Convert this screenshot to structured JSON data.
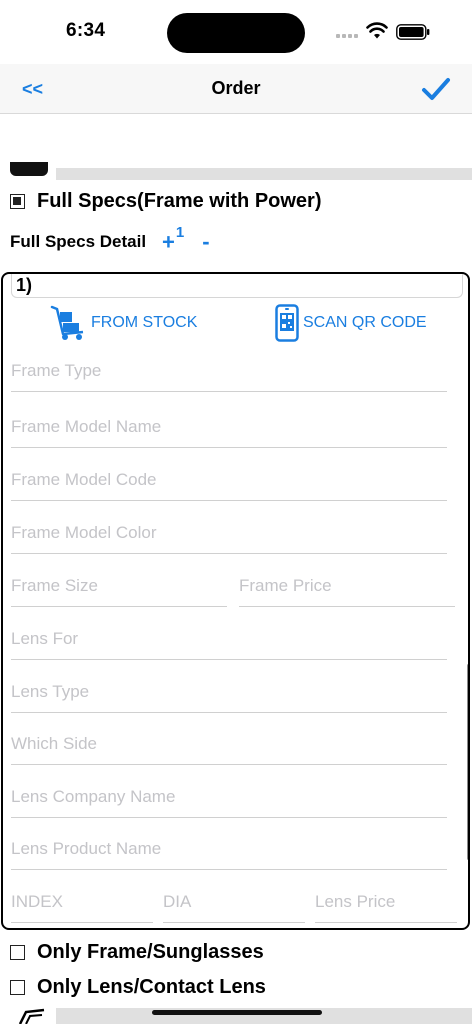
{
  "status_bar": {
    "time": "6:34"
  },
  "nav": {
    "back_label": "<<",
    "title": "Order",
    "done_icon": "checkmark-icon"
  },
  "options": {
    "full_specs": {
      "label": "Full Specs(Frame with Power)",
      "checked": true
    },
    "only_frame": {
      "label": "Only Frame/Sunglasses",
      "checked": false
    },
    "only_lens": {
      "label": "Only Lens/Contact Lens",
      "checked": false
    }
  },
  "detail": {
    "label": "Full Specs Detail",
    "plus_label": "+",
    "count": "1",
    "minus_label": "-"
  },
  "item": {
    "number": "1)",
    "from_stock_label": "FROM STOCK",
    "scan_qr_label": "SCAN QR CODE",
    "fields": {
      "frame_type": "Frame Type",
      "frame_model_name": "Frame Model Name",
      "frame_model_code": "Frame Model Code",
      "frame_model_color": "Frame Model Color",
      "frame_size": "Frame Size",
      "frame_price": "Frame Price",
      "lens_for": "Lens For",
      "lens_type": "Lens Type",
      "which_side": "Which Side",
      "lens_company_name": "Lens Company Name",
      "lens_product_name": "Lens Product Name",
      "index": "INDEX",
      "dia": "DIA",
      "lens_price": "Lens Price"
    }
  },
  "colors": {
    "accent": "#1a7ee0",
    "placeholder": "#c4c4c8",
    "divider": "#d0d0d0"
  }
}
